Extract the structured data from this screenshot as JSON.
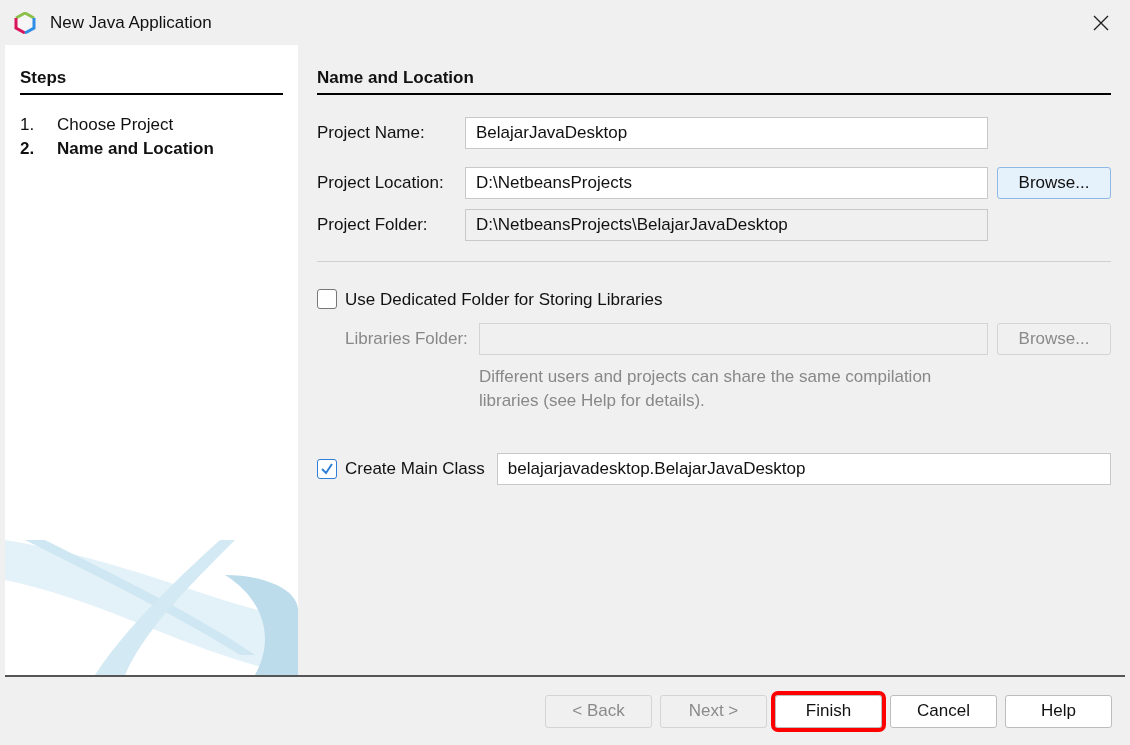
{
  "window": {
    "title": "New Java Application"
  },
  "steps": {
    "heading": "Steps",
    "items": [
      {
        "number": "1.",
        "label": "Choose Project",
        "selected": false
      },
      {
        "number": "2.",
        "label": "Name and Location",
        "selected": true
      }
    ]
  },
  "panel": {
    "heading": "Name and Location",
    "fields": [
      {
        "label": "Project Name:",
        "value": "BelajarJavaDesktop",
        "kind": "editable"
      },
      {
        "label": "Project Location:",
        "value": "D:\\NetbeansProjects",
        "kind": "editable",
        "button": {
          "label": "Browse...",
          "disabled": false,
          "focused": true
        }
      },
      {
        "label": "Project Folder:",
        "value": "D:\\NetbeansProjects\\BelajarJavaDesktop",
        "kind": "readonly"
      }
    ],
    "libraries": {
      "checkbox": {
        "label": "Use Dedicated Folder for Storing Libraries",
        "checked": false
      },
      "field_label": "Libraries Folder:",
      "button": {
        "label": "Browse...",
        "disabled": true
      },
      "hint": "Different users and projects can share the same compilation libraries (see Help for details)."
    },
    "main_class": {
      "checkbox": {
        "label": "Create Main Class",
        "checked": true
      },
      "value": "belajarjavadesktop.BelajarJavaDesktop"
    }
  },
  "buttons": [
    {
      "label": "< Back",
      "disabled": true,
      "highlighted": false
    },
    {
      "label": "Next >",
      "disabled": true,
      "highlighted": false
    },
    {
      "label": "Finish",
      "disabled": false,
      "highlighted": true
    },
    {
      "label": "Cancel",
      "disabled": false,
      "highlighted": false
    },
    {
      "label": "Help",
      "disabled": false,
      "highlighted": false
    }
  ]
}
